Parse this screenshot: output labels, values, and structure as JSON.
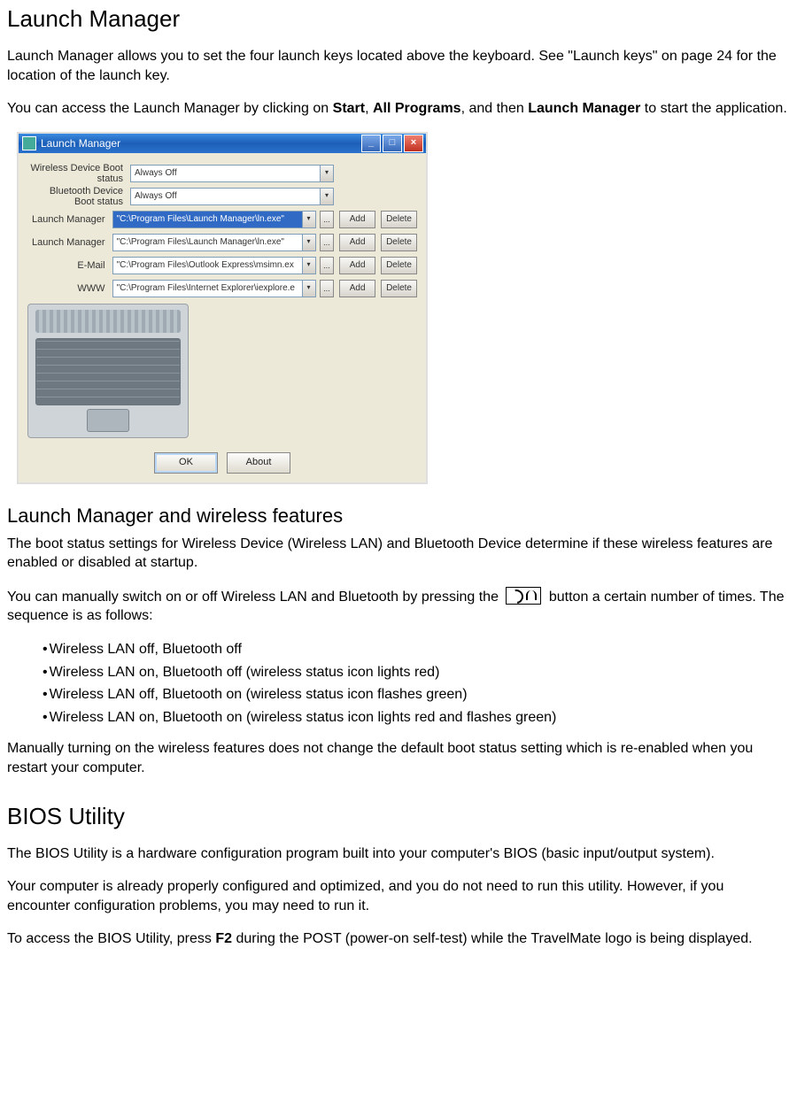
{
  "h1_a": "Launch Manager",
  "p1_a": "Launch  Manager allows you to set the four launch keys located above the keyboard.  See \"Launch keys\" on page 24 for the location of the launch key.",
  "p1_b_pre": "You can access the Launch Manager by clicking on ",
  "p1_b_s1": "Start",
  "p1_b_sep1": ", ",
  "p1_b_s2": "All Programs",
  "p1_b_sep2": ", and then ",
  "p1_b_s3": "Launch Manager",
  "p1_b_post": " to start the application.",
  "window": {
    "title": "Launch Manager",
    "rows": [
      {
        "label": "Wireless Device Boot status",
        "value": "Always Off",
        "selected": false,
        "cfg": false
      },
      {
        "label": "Bluetooth Device Boot status",
        "value": "Always Off",
        "selected": false,
        "cfg": false
      },
      {
        "label": "Launch Manager",
        "value": "\"C:\\Program Files\\Launch Manager\\ln.exe\"",
        "selected": true,
        "cfg": true
      },
      {
        "label": "Launch Manager",
        "value": "\"C:\\Program Files\\Launch Manager\\ln.exe\"",
        "selected": false,
        "cfg": true
      },
      {
        "label": "E-Mail",
        "value": "\"C:\\Program Files\\Outlook Express\\msimn.ex",
        "selected": false,
        "cfg": true
      },
      {
        "label": "WWW",
        "value": "\"C:\\Program Files\\Internet Explorer\\iexplore.e",
        "selected": false,
        "cfg": true
      }
    ],
    "more": "...",
    "add": "Add",
    "delete": "Delete",
    "ok": "OK",
    "about": "About"
  },
  "h2_a": "Launch Manager and wireless features",
  "p2_a": "The boot status settings for Wireless Device (Wireless LAN) and Bluetooth Device determine if these wireless features are enabled or disabled at startup.",
  "p2_b_pre": "You can manually switch on or off Wireless LAN and Bluetooth by pressing the ",
  "p2_b_post": " button a certain number of times. The sequence is as follows:",
  "seq": [
    "Wireless LAN off, Bluetooth off",
    "Wireless LAN on, Bluetooth off (wireless status icon lights red)",
    "Wireless LAN off, Bluetooth on (wireless status icon flashes green)",
    "Wireless LAN on, Bluetooth on (wireless status icon lights red and flashes green)"
  ],
  "p2_c": "Manually turning on the wireless features does not change the default boot status setting which is re-enabled when you restart your computer.",
  "h1_b": "BIOS Utility",
  "p3_a": "The BIOS Utility is a hardware configuration program built into your computer's BIOS (basic input/output system).",
  "p3_b": "Your computer is already properly configured and optimized, and you do not need to run this utility.  However, if you encounter configuration problems, you may need to run it.",
  "p3_c_pre": "To access the BIOS Utility, press ",
  "p3_c_key": "F2",
  "p3_c_post": " during the POST (power-on self-test)  while the TravelMate logo is being displayed."
}
